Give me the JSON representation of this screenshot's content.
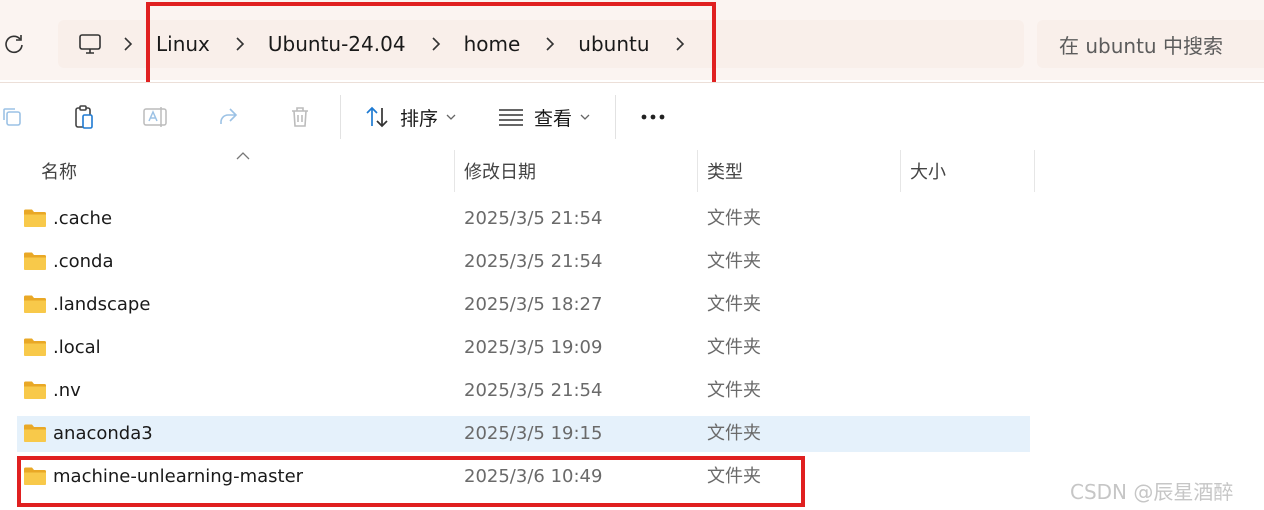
{
  "address_bar": {
    "refresh_icon": "refresh-icon",
    "pc_icon": "computer-icon",
    "crumbs": [
      "Linux",
      "Ubuntu-24.04",
      "home",
      "ubuntu"
    ],
    "search_placeholder": "在 ubuntu 中搜索"
  },
  "toolbar": {
    "icons": [
      "copy-icon",
      "paste-icon",
      "rename-icon",
      "share-icon",
      "delete-icon"
    ],
    "sort_label": "排序",
    "view_label": "查看",
    "more_label": "•••"
  },
  "columns": {
    "name": "名称",
    "modified": "修改日期",
    "type": "类型",
    "size": "大小"
  },
  "files": [
    {
      "name": ".cache",
      "modified": "2025/3/5 21:54",
      "type": "文件夹",
      "selected": false
    },
    {
      "name": ".conda",
      "modified": "2025/3/5 21:54",
      "type": "文件夹",
      "selected": false
    },
    {
      "name": ".landscape",
      "modified": "2025/3/5 18:27",
      "type": "文件夹",
      "selected": false
    },
    {
      "name": ".local",
      "modified": "2025/3/5 19:09",
      "type": "文件夹",
      "selected": false
    },
    {
      "name": ".nv",
      "modified": "2025/3/5 21:54",
      "type": "文件夹",
      "selected": false
    },
    {
      "name": "anaconda3",
      "modified": "2025/3/5 19:15",
      "type": "文件夹",
      "selected": true
    },
    {
      "name": "machine-unlearning-master",
      "modified": "2025/3/6 10:49",
      "type": "文件夹",
      "selected": false
    }
  ],
  "watermark": "CSDN @辰星酒醉",
  "colors": {
    "highlight_box": "#e02020",
    "selected_row": "#e5f1fb",
    "folder": "#f6c244"
  }
}
